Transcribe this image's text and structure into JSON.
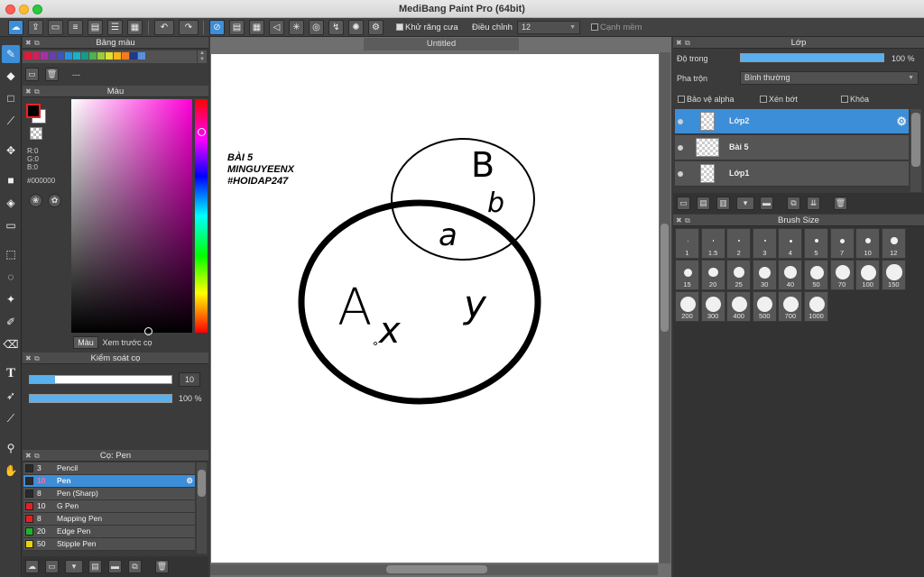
{
  "window": {
    "title": "MediBang Paint Pro (64bit)"
  },
  "toolbar": {
    "anti_alias_label": "Khử răng cưa",
    "correction_label": "Điều chỉnh",
    "correction_value": "12",
    "smooth_edge_label": "Cạnh mềm"
  },
  "palette_panel": {
    "title": "Bảng màu",
    "dashes": "---"
  },
  "color_panel": {
    "title": "Màu",
    "r": "R:0",
    "g": "G:0",
    "b": "B:0",
    "hex": "#000000",
    "tab_color": "Màu",
    "tab_brush_preview": "Xem trước cọ",
    "foreground": "#000000",
    "background": "#ffffff"
  },
  "brush_control": {
    "title": "Kiểm soát cọ",
    "size_value": "10",
    "size_fraction": 0.18,
    "opacity_value": "100 %",
    "opacity_fraction": 1.0
  },
  "brush_panel": {
    "title": "Cọ: Pen",
    "items": [
      {
        "size": "3",
        "name": "Pencil",
        "color": "#2a2a2a"
      },
      {
        "size": "10",
        "name": "Pen",
        "color": "#2a2a2a"
      },
      {
        "size": "8",
        "name": "Pen (Sharp)",
        "color": "#2a2a2a"
      },
      {
        "size": "10",
        "name": "G Pen",
        "color": "#e52020"
      },
      {
        "size": "8",
        "name": "Mapping Pen",
        "color": "#e52020"
      },
      {
        "size": "20",
        "name": "Edge Pen",
        "color": "#22b22a"
      },
      {
        "size": "50",
        "name": "Stipple Pen",
        "color": "#e8d20c"
      }
    ]
  },
  "document": {
    "tab_title": "Untitled",
    "note_line1": "BÀI 5",
    "note_line2": "MINGUYEENX",
    "note_line3": "#HOIDAP247",
    "label_big_set": "A",
    "label_small_set": "B",
    "label_intersection": "a",
    "label_b": "b",
    "label_x": "x",
    "label_y": "y"
  },
  "layer_panel": {
    "title": "Lớp",
    "opacity_label": "Độ trong",
    "opacity_value": "100 %",
    "opacity_fraction": 1.0,
    "blend_label": "Pha trộn",
    "blend_value": "Bình thường",
    "protect_alpha": "Bảo vệ alpha",
    "clipping": "Xén bớt",
    "lock": "Khóa",
    "layers": [
      {
        "name": "Lớp2"
      },
      {
        "name": "Bài 5"
      },
      {
        "name": "Lớp1"
      }
    ]
  },
  "brush_size_panel": {
    "title": "Brush Size",
    "sizes": [
      "1",
      "1.5",
      "2",
      "3",
      "4",
      "5",
      "7",
      "10",
      "12",
      "15",
      "20",
      "25",
      "30",
      "40",
      "50",
      "70",
      "100",
      "150",
      "200",
      "300",
      "400",
      "500",
      "700",
      "1000"
    ]
  }
}
